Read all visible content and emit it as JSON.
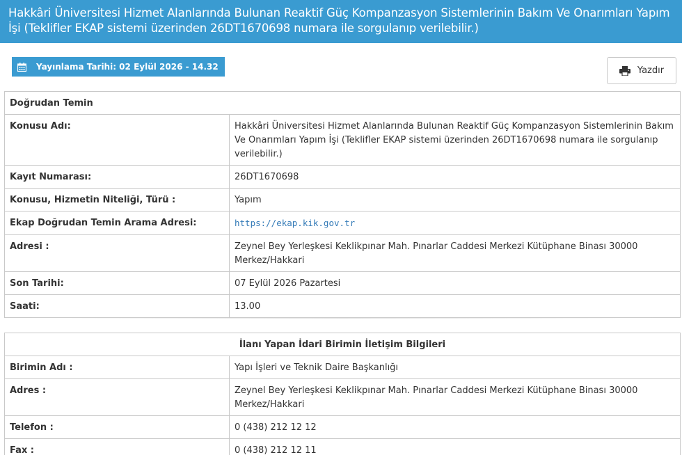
{
  "header": {
    "title": "Hakkâri Üniversitesi Hizmet Alanlarında Bulunan Reaktif Güç Kompanzasyon Sistemlerinin Bakım Ve Onarımları Yapım İşi (Teklifler EKAP sistemi üzerinden 26DT1670698 numara ile sorgulanıp verilebilir.)"
  },
  "publication": {
    "icon": "calendar-icon",
    "label": "Yayınlama Tarihi: 02 Eylül 2026 - 14.32"
  },
  "print": {
    "icon": "printer-icon",
    "label": "Yazdır"
  },
  "details": {
    "heading": "Doğrudan Temin",
    "rows": [
      {
        "label": "Konusu Adı:",
        "value": "Hakkâri Üniversitesi Hizmet Alanlarında Bulunan Reaktif Güç Kompanzasyon Sistemlerinin Bakım Ve Onarımları Yapım İşi (Teklifler EKAP sistemi üzerinden 26DT1670698 numara ile sorgulanıp verilebilir.)"
      },
      {
        "label": "Kayıt Numarası:",
        "value": "26DT1670698"
      },
      {
        "label": "Konusu, Hizmetin Niteliği, Türü :",
        "value": "Yapım"
      },
      {
        "label": "Ekap Doğrudan Temin Arama Adresi:",
        "value": "https://ekap.kik.gov.tr"
      },
      {
        "label": "Adresi :",
        "value": "Zeynel Bey Yerleşkesi Keklikpınar Mah. Pınarlar Caddesi Merkezi Kütüphane Binası 30000 Merkez/Hakkari"
      },
      {
        "label": "Son Tarihi:",
        "value": "07 Eylül 2026 Pazartesi"
      },
      {
        "label": "Saati:",
        "value": "13.00"
      }
    ]
  },
  "contact": {
    "heading": "İlanı Yapan İdari Birimin İletişim Bilgileri",
    "rows": [
      {
        "label": "Birimin Adı :",
        "value": "Yapı İşleri ve Teknik Daire Başkanlığı"
      },
      {
        "label": "Adres :",
        "value": "Zeynel Bey Yerleşkesi Keklikpınar Mah. Pınarlar Caddesi Merkezi Kütüphane Binası 30000 Merkez/Hakkari"
      },
      {
        "label": "Telefon :",
        "value": "0 (438) 212 12 12"
      },
      {
        "label": "Fax :",
        "value": "0 (438) 212 12 11"
      }
    ]
  }
}
